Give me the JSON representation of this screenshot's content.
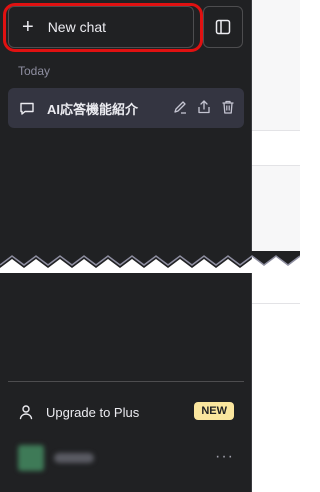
{
  "sidebar": {
    "new_chat_label": "New chat",
    "new_chat_icon": "plus-icon",
    "toggle_icon": "sidebar-toggle-icon",
    "section_today": "Today",
    "chats": [
      {
        "title": "AI応答機能紹介",
        "icon": "chat-bubble-icon",
        "actions": [
          "edit-icon",
          "share-icon",
          "delete-icon"
        ]
      }
    ],
    "upgrade_label": "Upgrade to Plus",
    "upgrade_badge": "NEW",
    "more_label": "···"
  },
  "colors": {
    "sidebar_bg": "#202123",
    "item_bg": "#343541",
    "highlight": "#e01111",
    "badge_bg": "#fae69e"
  }
}
